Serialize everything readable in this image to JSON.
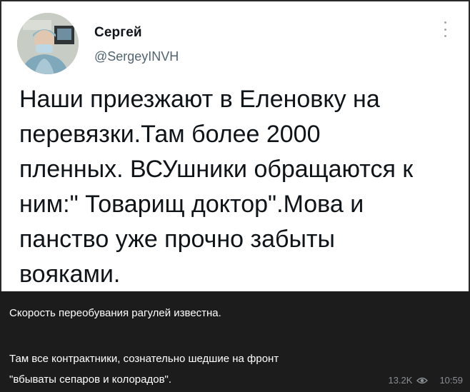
{
  "tweet": {
    "display_name": "Сергей",
    "handle": "@SergeyINVH",
    "text": "Наши приезжают в Еленовку на\nперевязки.Там более 2000\nпленных. ВСУшники обращаются к\nним:\" Товарищ доктор\".Мова и\nпанство уже прочно забыты\nвояками.",
    "more_icon": "more-vertical-icon"
  },
  "caption": {
    "line1": "Скорость переобувания рагулей известна.",
    "line2": "Там все контрактники, сознательно шедшие на фронт",
    "line3": "\"вбываты сепаров и колорадов\".",
    "views": "13.2K",
    "views_icon": "eye-icon",
    "time": "10:59"
  },
  "colors": {
    "caption_bg": "#1c1c1d",
    "caption_text": "#ffffff",
    "meta_text": "#8a8d91",
    "tweet_text": "#0f1419",
    "handle_text": "#536471"
  }
}
